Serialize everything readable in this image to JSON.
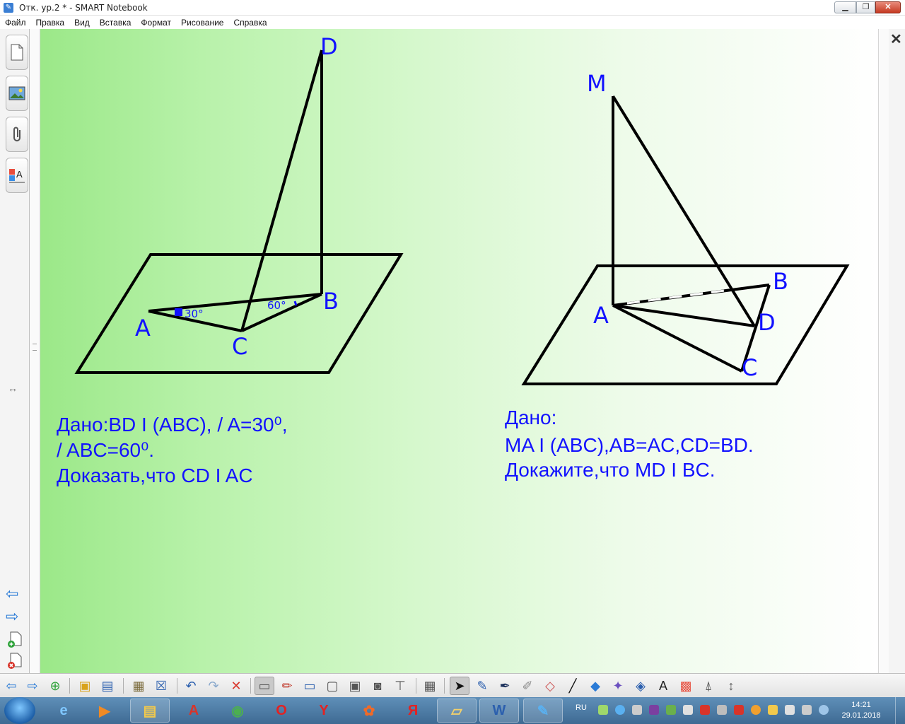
{
  "window": {
    "title": "Отк. ур.2 * - SMART Notebook"
  },
  "menu": [
    "Файл",
    "Правка",
    "Вид",
    "Вставка",
    "Формат",
    "Рисование",
    "Справка"
  ],
  "figure1": {
    "labels": {
      "D": "D",
      "A": "A",
      "B": "B",
      "C": "C"
    },
    "angle_a": "30°",
    "angle_b": "60°",
    "given_line1": "Дано:BD  I  (ABC),  / A=30⁰,",
    "given_line2": "/ ABC=60⁰.",
    "prove": "Доказать,что CD  I  AC"
  },
  "figure2": {
    "labels": {
      "M": "M",
      "A": "A",
      "B": "B",
      "C": "C",
      "D": "D"
    },
    "given_title": "Дано:",
    "given_line": "MA  I  (ABC),AB=AC,CD=BD.",
    "prove": "Докажите,что MD  I  BC."
  },
  "tray": {
    "lang": "RU",
    "time": "14:21",
    "date": "29.01.2018"
  },
  "colors": {
    "accent": "#1212ff",
    "line": "#000000"
  }
}
